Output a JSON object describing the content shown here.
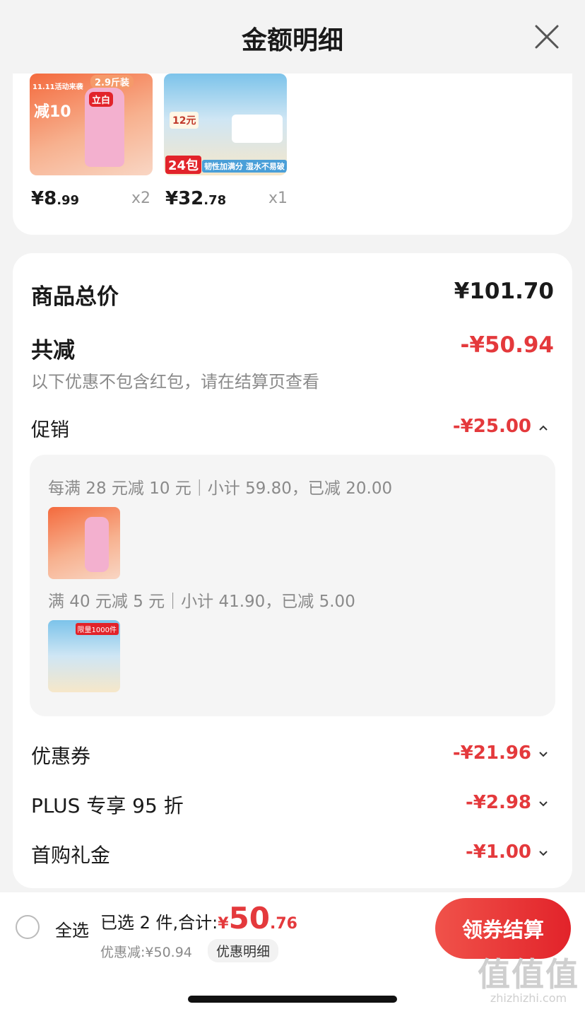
{
  "header": {
    "title": "金额明细"
  },
  "items": [
    {
      "price_int": "¥8",
      "price_dec": ".99",
      "qty": "x2",
      "badge_top": "11.11活动来袭",
      "badge_mid": "减10",
      "brand": "立白",
      "tag": "2.9斤装"
    },
    {
      "price_int": "¥32",
      "price_dec": ".78",
      "qty": "x1",
      "badge_mid": "12元",
      "pack": "24包",
      "slogan": "韧性加满分 湿水不易破"
    }
  ],
  "summary": {
    "total_label": "商品总价",
    "total_value": "¥101.70",
    "reduce_label": "共减",
    "reduce_value": "-¥50.94",
    "note": "以下优惠不包含红包，请在结算页查看",
    "promo_label": "促销",
    "promo_value": "-¥25.00",
    "promo_rules": [
      "每满 28 元减 10 元｜小计 59.80，已减 20.00",
      "满 40 元减 5 元｜小计 41.90，已减 5.00"
    ],
    "promo_thumb2_tag": "限量1000件",
    "coupon_label": "优惠券",
    "coupon_value": "-¥21.96",
    "plus_label": "PLUS 专享 95 折",
    "plus_value": "-¥2.98",
    "gift_label": "首购礼金",
    "gift_value": "-¥1.00"
  },
  "bottom": {
    "select_all": "全选",
    "selected_text": "已选 2 件,合计:",
    "total_symbol": "¥",
    "total_int": "50",
    "total_dec": ".76",
    "discount_text": "优惠减:¥50.94",
    "detail_link": "优惠明细",
    "checkout_button": "领券结算"
  },
  "watermark": {
    "brand": "值值值",
    "domain": "zhizhizhi.com"
  },
  "colors": {
    "accent": "#e4393c",
    "background": "#f3f3f3"
  }
}
